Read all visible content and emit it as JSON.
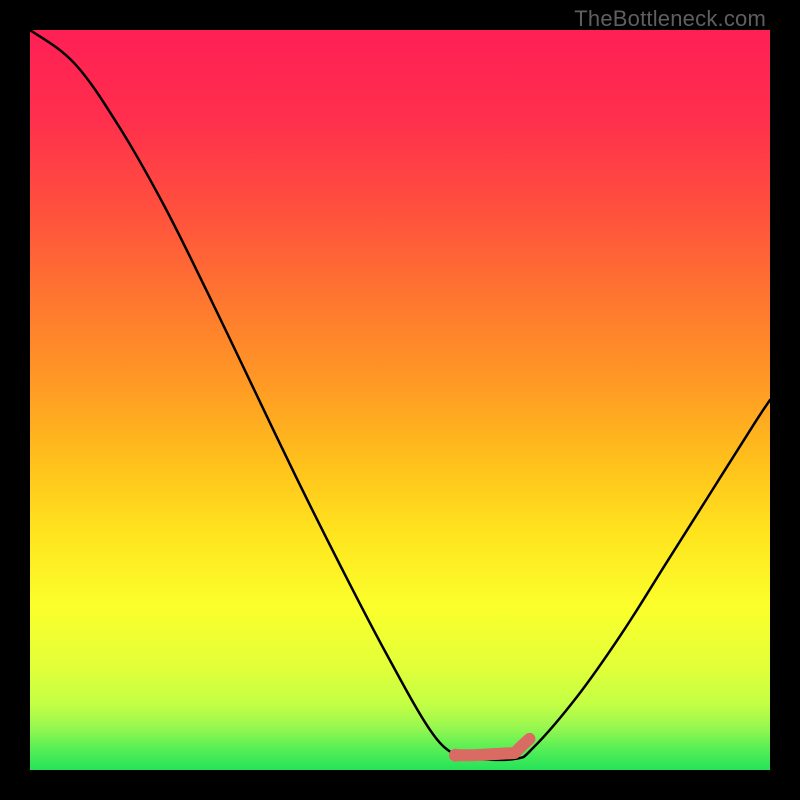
{
  "watermark": "TheBottleneck.com",
  "chart_data": {
    "type": "line",
    "title": "",
    "xlabel": "",
    "ylabel": "",
    "xlim": [
      0,
      1
    ],
    "ylim": [
      0,
      1
    ],
    "curve": {
      "description": "bottleneck V-curve, high on left falling to min around x≈0.58 then rising to right",
      "x": [
        0.0,
        0.06,
        0.12,
        0.18,
        0.24,
        0.3,
        0.36,
        0.42,
        0.48,
        0.54,
        0.575,
        0.6,
        0.655,
        0.68,
        0.74,
        0.8,
        0.86,
        0.92,
        0.98,
        1.0
      ],
      "y": [
        1.0,
        0.955,
        0.87,
        0.765,
        0.645,
        0.52,
        0.395,
        0.275,
        0.16,
        0.055,
        0.02,
        0.015,
        0.015,
        0.03,
        0.1,
        0.185,
        0.28,
        0.375,
        0.47,
        0.5
      ]
    },
    "marker_segment": {
      "color": "#d96b63",
      "start_dot": {
        "x": 0.575,
        "y": 0.02
      },
      "line": [
        {
          "x": 0.575,
          "y": 0.02
        },
        {
          "x": 0.6,
          "y": 0.02
        },
        {
          "x": 0.655,
          "y": 0.023
        },
        {
          "x": 0.665,
          "y": 0.033
        },
        {
          "x": 0.675,
          "y": 0.042
        }
      ]
    },
    "green_band": {
      "y_start": 0.0,
      "y_end": 0.06,
      "color": "#24e35a"
    },
    "gradient_stops": [
      {
        "offset": 0.0,
        "color": "#ff1f55"
      },
      {
        "offset": 0.12,
        "color": "#ff2f4d"
      },
      {
        "offset": 0.24,
        "color": "#ff4f3e"
      },
      {
        "offset": 0.36,
        "color": "#ff7530"
      },
      {
        "offset": 0.48,
        "color": "#ff9a24"
      },
      {
        "offset": 0.58,
        "color": "#ffbf1c"
      },
      {
        "offset": 0.68,
        "color": "#ffe41e"
      },
      {
        "offset": 0.78,
        "color": "#fbff2b"
      },
      {
        "offset": 0.86,
        "color": "#e2ff39"
      },
      {
        "offset": 0.91,
        "color": "#c4ff44"
      },
      {
        "offset": 0.94,
        "color": "#9cf84f"
      },
      {
        "offset": 0.97,
        "color": "#5aef55"
      },
      {
        "offset": 1.0,
        "color": "#24e35a"
      }
    ]
  }
}
